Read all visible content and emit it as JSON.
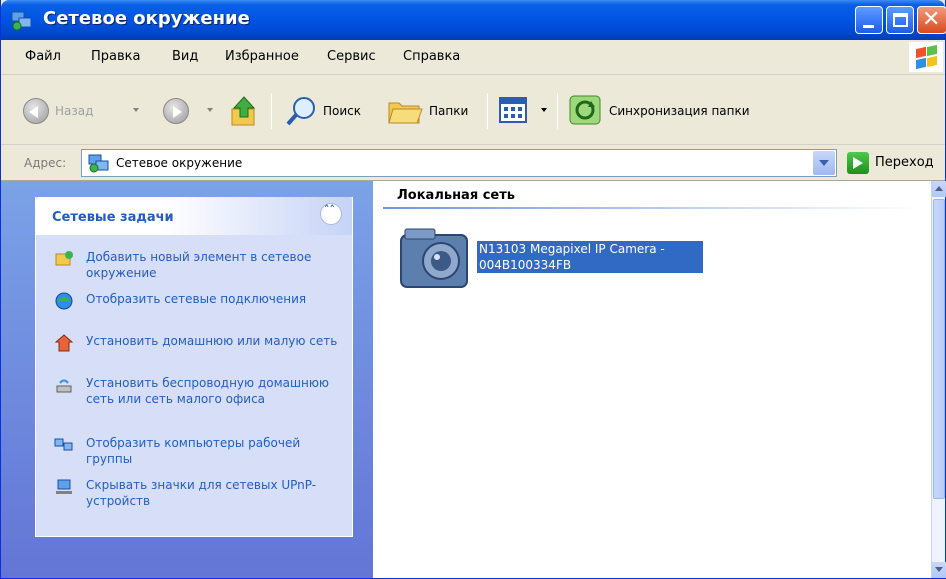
{
  "window": {
    "title": "Сетевое окружение"
  },
  "menu": {
    "items": [
      "Файл",
      "Правка",
      "Вид",
      "Избранное",
      "Сервис",
      "Справка"
    ]
  },
  "toolbar": {
    "back_label": "Назад",
    "search_label": "Поиск",
    "folders_label": "Папки",
    "sync_label": "Синхронизация папки"
  },
  "address": {
    "label": "Адрес:",
    "value": "Сетевое окружение",
    "go_label": "Переход"
  },
  "tasks": {
    "title": "Сетевые задачи",
    "collapse_glyph": "˄˄",
    "items": [
      {
        "label": "Добавить новый элемент в сетевое окружение",
        "icon": "add-network-place-icon"
      },
      {
        "label": "Отобразить сетевые подключения",
        "icon": "network-connections-icon"
      },
      {
        "label": "Установить домашнюю или малую сеть",
        "icon": "home-network-icon"
      },
      {
        "label": "Установить беспроводную домашнюю сеть или сеть малого офиса",
        "icon": "wireless-network-icon"
      },
      {
        "label": "Отобразить компьютеры рабочей группы",
        "icon": "workgroup-computers-icon"
      },
      {
        "label": "Скрывать значки для сетевых UPnP-устройств",
        "icon": "upnp-icon"
      }
    ]
  },
  "content": {
    "group_title": "Локальная сеть",
    "items": [
      {
        "line1": "N13103 Megapixel IP Camera -",
        "line2": "004B100334FB",
        "icon": "ip-camera-icon"
      }
    ]
  },
  "colors": {
    "title_bar": "#0054e3",
    "task_link": "#215dc6",
    "selection": "#316ac5"
  }
}
